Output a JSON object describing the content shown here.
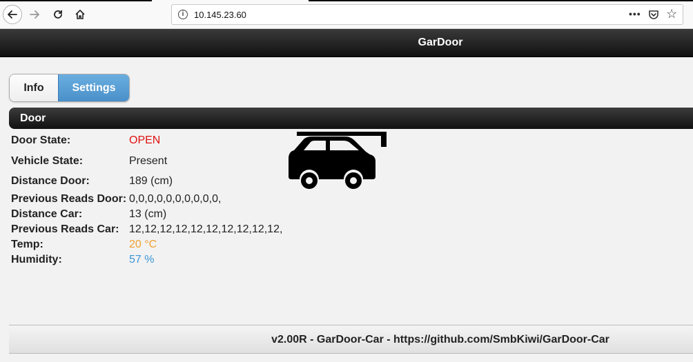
{
  "browser": {
    "url": "10.145.23.60",
    "icons": [
      "back-icon",
      "forward-icon",
      "reload-icon",
      "home-icon",
      "info-icon",
      "more-icon",
      "pocket-icon",
      "bookmark-star-icon"
    ]
  },
  "app": {
    "title": "GarDoor"
  },
  "tabs": [
    {
      "label": "Info",
      "active": false
    },
    {
      "label": "Settings",
      "active": true
    }
  ],
  "door_section": {
    "title": "Door",
    "rows": [
      {
        "label": "Door State:",
        "value": "OPEN",
        "color": "#e01010"
      },
      {
        "label": "Vehicle State:",
        "value": "Present"
      },
      {
        "label": "Distance Door:",
        "value": "189 (cm)"
      },
      {
        "label": "Previous Reads Door:",
        "value": "0,0,0,0,0,0,0,0,0,0,"
      },
      {
        "label": "Distance Car:",
        "value": "13 (cm)"
      },
      {
        "label": "Previous Reads Car:",
        "value": "12,12,12,12,12,12,12,12,12,12,"
      },
      {
        "label": "Temp:",
        "value": "20 °C",
        "color": "#f0a030"
      },
      {
        "label": "Humidity:",
        "value": "57 %",
        "color": "#3a95d8"
      }
    ],
    "status_icon": "car-in-garage-icon"
  },
  "footer": {
    "text": "v2.00R - GarDoor-Car - https://github.com/SmbKiwi/GarDoor-Car"
  },
  "colors": {
    "accent": "#4a90c9",
    "header": "#111111"
  }
}
